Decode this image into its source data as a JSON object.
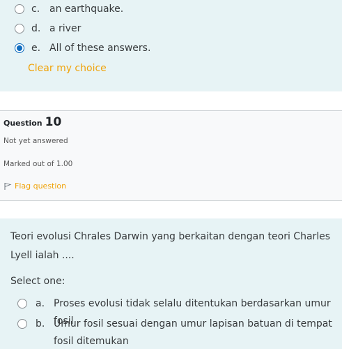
{
  "prev_question": {
    "options": [
      {
        "letter": "c.",
        "text": "an earthquake.",
        "checked": false
      },
      {
        "letter": "d.",
        "text": "a river",
        "checked": false
      },
      {
        "letter": "e.",
        "text": "All of these answers.",
        "checked": true
      }
    ],
    "clear_label": "Clear my choice"
  },
  "info": {
    "question_label": "Question",
    "question_number": "10",
    "state": "Not yet answered",
    "grade": "Marked out of 1.00",
    "flag_label": "Flag question"
  },
  "question": {
    "text": "Teori evolusi Chrales Darwin yang berkaitan dengan teori Charles Lyell ialah ....",
    "prompt": "Select one:",
    "answers": [
      {
        "letter": "a.",
        "text": "Proses evolusi tidak selalu ditentukan berdasarkan umur fosil",
        "checked": false
      },
      {
        "letter": "b.",
        "text": "Umur fosil sesuai dengan umur lapisan batuan di tempat fosil ditemukan",
        "checked": false
      }
    ]
  },
  "colors": {
    "accent": "#0f6cbf",
    "link": "#f0a30a",
    "formulation_bg": "#e7f3f5",
    "info_bg": "#f8f9fa"
  }
}
